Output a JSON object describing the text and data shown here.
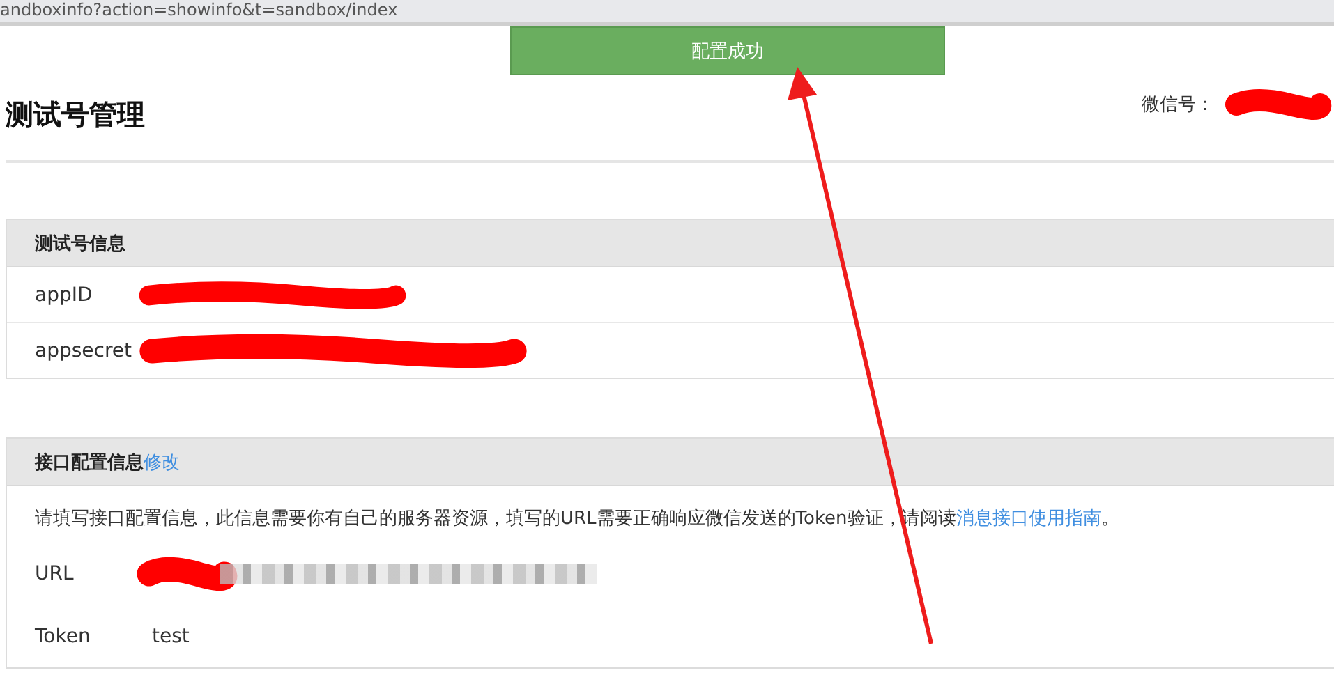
{
  "browser": {
    "address": "andboxinfo?action=showinfo&t=sandbox/index"
  },
  "notice": {
    "text": "配置成功"
  },
  "header": {
    "title": "测试号管理",
    "account_label": "微信号：",
    "account_redacted": true
  },
  "panels": [
    {
      "title": "测试号信息",
      "rows": [
        {
          "label": "appID",
          "redacted": true,
          "blurred": false
        },
        {
          "label": "appsecret",
          "redacted": true,
          "blurred": false
        }
      ]
    },
    {
      "title": "接口配置信息",
      "action": "修改",
      "description": "请填写接口配置信息，此信息需要你有自己的服务器资源，填写的URL需要正确响应微信发送的Token验证，请阅读",
      "description_link": "消息接口使用指南",
      "description_end": "。",
      "rows": [
        {
          "label": "URL",
          "redacted": true,
          "blurred": true
        },
        {
          "label": "Token",
          "redacted": false,
          "blurred": false,
          "value": "test"
        }
      ]
    }
  ],
  "annotations": [
    {
      "kind": "arrow"
    }
  ]
}
